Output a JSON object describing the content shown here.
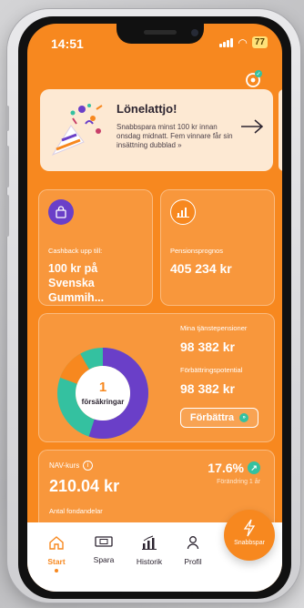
{
  "status_bar": {
    "time": "14:51",
    "battery": "77"
  },
  "banner": {
    "title": "Lönelattjo!",
    "text": "Snabbspara minst 100 kr innan onsdag midnatt. Fem vinnare får sin insättning dubblad »"
  },
  "cashback_card": {
    "label": "Cashback upp till:",
    "value_line1": "100 kr på",
    "value_line2": "Svenska Gummih..."
  },
  "pension_card": {
    "label": "Pensionsprognos",
    "value": "405 234 kr"
  },
  "insurance_card": {
    "count": "1",
    "count_label": "försäkringar",
    "pensions_label": "Mina tjänstepensioner",
    "pensions_value": "98 382 kr",
    "potential_label": "Förbättringspotential",
    "potential_value": "98 382 kr",
    "improve_button": "Förbättra",
    "colors": {
      "purple": "#6a3fc8",
      "teal": "#34c1a0",
      "orange": "#f7881f"
    }
  },
  "nav_card": {
    "label": "NAV-kurs",
    "value": "210.04 kr",
    "change_value": "17.6%",
    "change_label": "Förändring 1 år",
    "units_label": "Antal fondandelar"
  },
  "tabbar": {
    "tabs": [
      {
        "label": "Start",
        "icon": "home-icon",
        "active": true
      },
      {
        "label": "Spara",
        "icon": "cash-icon",
        "active": false
      },
      {
        "label": "Historik",
        "icon": "chart-icon",
        "active": false
      },
      {
        "label": "Profil",
        "icon": "person-icon",
        "active": false
      }
    ],
    "fab_label": "Snabbspar"
  },
  "colors": {
    "brand": "#f7881f",
    "banner_bg": "#fde9d3",
    "accent_teal": "#34c1a0",
    "accent_purple": "#6a3fc8"
  }
}
